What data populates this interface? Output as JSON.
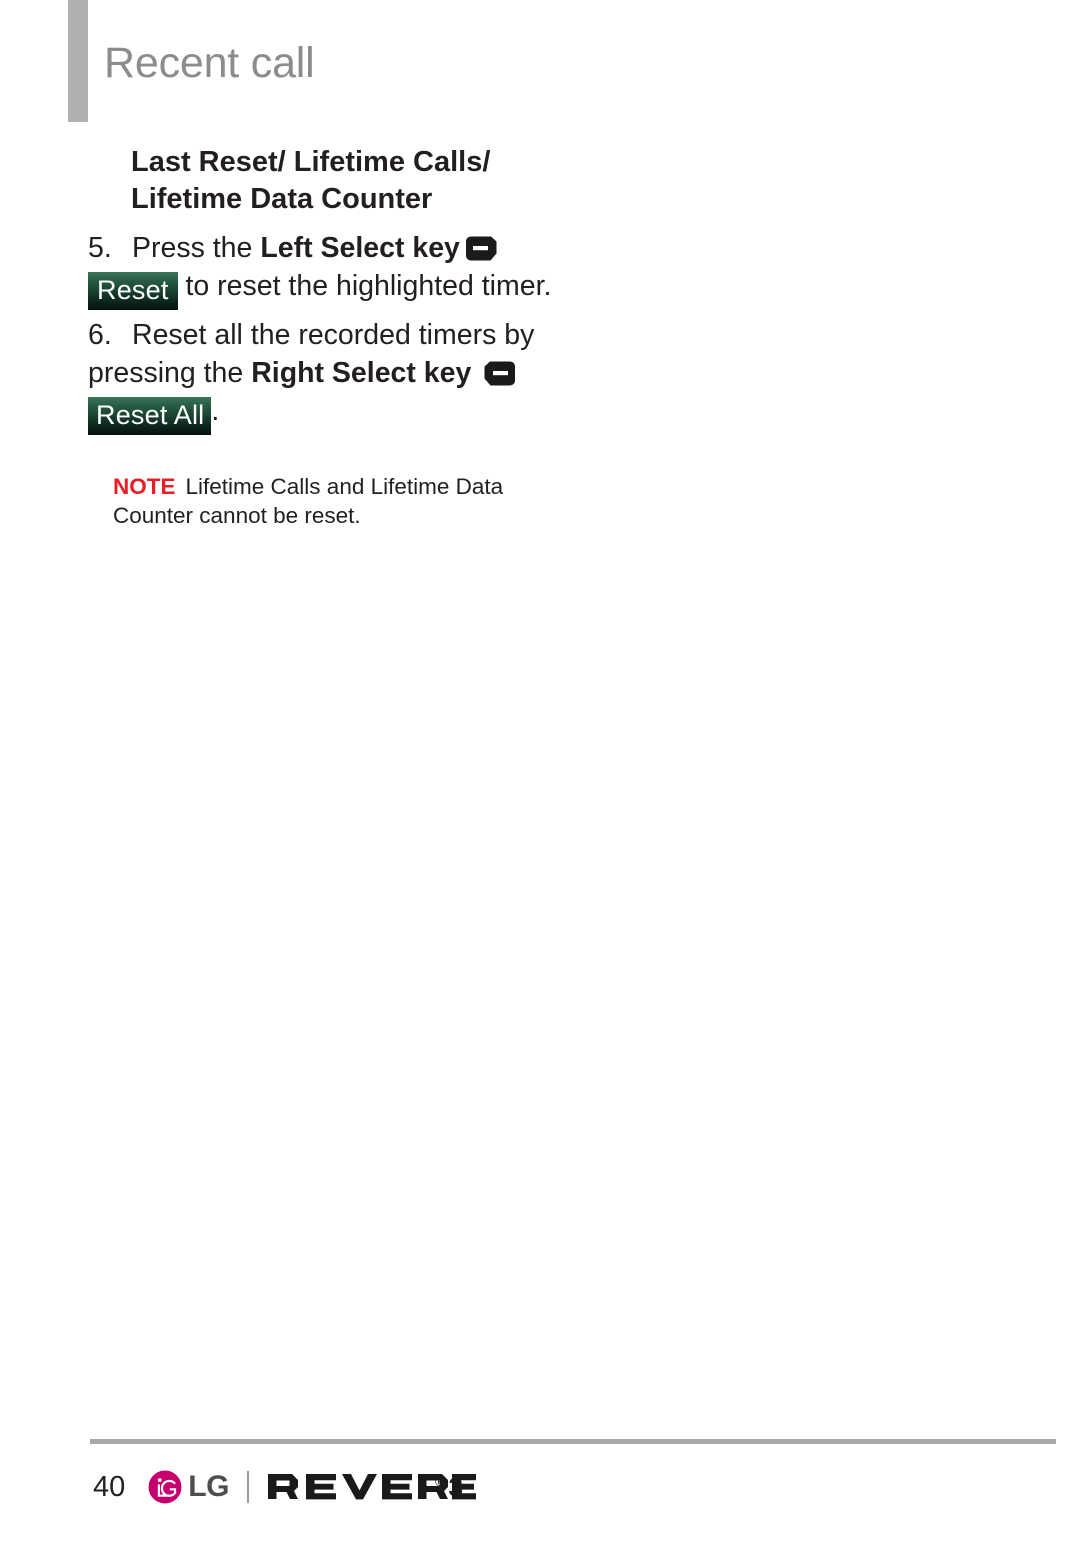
{
  "header": {
    "title": "Recent call",
    "accent_bar_color": "#b0b0b0",
    "title_color": "#8c8c8c"
  },
  "section": {
    "heading": "Last Reset/ Lifetime Calls/ Lifetime Data Counter"
  },
  "steps": [
    {
      "number": "5.",
      "text_before": "Press the ",
      "bold_text": "Left Select key",
      "key_icon": "left-select-key-icon",
      "chip_label": "Reset",
      "text_after": " to reset the highlighted timer."
    },
    {
      "number": "6.",
      "text_before": "Reset all the recorded timers by pressing the ",
      "bold_text": "Right Select key",
      "key_icon": "right-select-key-icon",
      "chip_label": "Reset All",
      "text_after": "."
    }
  ],
  "note": {
    "label": "NOTE",
    "label_color": "#ec1c24",
    "text": "Lifetime Calls and Lifetime Data Counter cannot be reset."
  },
  "footer": {
    "page_number": "40",
    "lg_wordmark": "LG",
    "lg_mark_color": "#c5006e",
    "product_name": "REVERE",
    "product_registered": "®",
    "product_version": "3",
    "rule_color": "#a8a8a8"
  },
  "theme": {
    "chip_gradient_top": "#39765a",
    "chip_gradient_bottom": "#05100b",
    "text_color": "#231f20"
  }
}
